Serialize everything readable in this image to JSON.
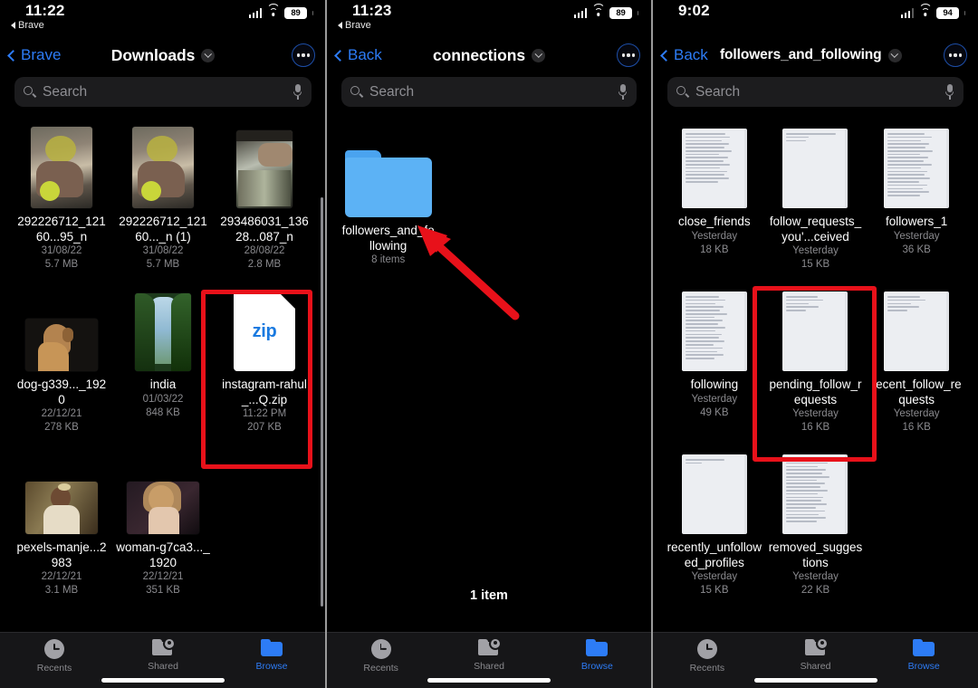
{
  "meta": {
    "app": "Files",
    "accent_blue": "#2d7cf6",
    "annotation_red": "#e8111a",
    "background": "#000000"
  },
  "panels": [
    {
      "id": "panel-1",
      "status": {
        "time": "11:22",
        "back_app": "Brave",
        "battery": "89",
        "signal_bars": 4,
        "wifi": true
      },
      "nav": {
        "back_label": "Brave",
        "title": "Downloads",
        "more_label": "More"
      },
      "search": {
        "placeholder": "Search"
      },
      "files": [
        {
          "name": "292226712_12160...95_n",
          "date": "31/08/22",
          "size": "5.7 MB",
          "kind": "photo-portrait",
          "highlight": false
        },
        {
          "name": "292226712_12160..._n (1)",
          "date": "31/08/22",
          "size": "5.7 MB",
          "kind": "photo-portrait",
          "highlight": false
        },
        {
          "name": "293486031_13628...087_n",
          "date": "28/08/22",
          "size": "2.8 MB",
          "kind": "photo-tall",
          "highlight": false
        },
        {
          "name": "dog-g339..._1920",
          "date": "22/12/21",
          "size": "278 KB",
          "kind": "photo-land-dog",
          "highlight": false
        },
        {
          "name": "india",
          "date": "01/03/22",
          "size": "848 KB",
          "kind": "photo-tall-india",
          "highlight": false
        },
        {
          "name": "instagram-rahul_...Q.zip",
          "date": "11:22 PM",
          "size": "207 KB",
          "kind": "zip",
          "highlight": true
        },
        {
          "name": "pexels-manje...2983",
          "date": "22/12/21",
          "size": "3.1 MB",
          "kind": "photo-land-woman1",
          "highlight": false
        },
        {
          "name": "woman-g7ca3..._1920",
          "date": "22/12/21",
          "size": "351 KB",
          "kind": "photo-land-woman2",
          "highlight": false
        }
      ],
      "tabs": [
        {
          "label": "Recents",
          "icon": "clock-icon",
          "active": false
        },
        {
          "label": "Shared",
          "icon": "shared-folder-icon",
          "active": false
        },
        {
          "label": "Browse",
          "icon": "folder-icon",
          "active": true
        }
      ]
    },
    {
      "id": "panel-2",
      "status": {
        "time": "11:23",
        "back_app": "Brave",
        "battery": "89",
        "signal_bars": 4,
        "wifi": true
      },
      "nav": {
        "back_label": "Back",
        "title": "connections",
        "more_label": "More"
      },
      "search": {
        "placeholder": "Search"
      },
      "files": [
        {
          "name": "followers_and_following",
          "date": "8 items",
          "size": "",
          "kind": "folder",
          "highlight": false
        }
      ],
      "item_count": "1 item",
      "tabs": [
        {
          "label": "Recents",
          "icon": "clock-icon",
          "active": false
        },
        {
          "label": "Shared",
          "icon": "shared-folder-icon",
          "active": false
        },
        {
          "label": "Browse",
          "icon": "folder-icon",
          "active": true
        }
      ]
    },
    {
      "id": "panel-3",
      "status": {
        "time": "9:02",
        "back_app": "",
        "battery": "94",
        "signal_bars": 3,
        "wifi": true
      },
      "nav": {
        "back_label": "Back",
        "title": "followers_and_following",
        "more_label": "More"
      },
      "search": {
        "placeholder": "Search"
      },
      "files": [
        {
          "name": "close_friends",
          "date": "Yesterday",
          "size": "18 KB",
          "kind": "doc-dense",
          "highlight": false
        },
        {
          "name": "follow_requests_you'...ceived",
          "date": "Yesterday",
          "size": "15 KB",
          "kind": "doc-sparse",
          "highlight": false
        },
        {
          "name": "followers_1",
          "date": "Yesterday",
          "size": "36 KB",
          "kind": "doc-dense",
          "highlight": false
        },
        {
          "name": "following",
          "date": "Yesterday",
          "size": "49 KB",
          "kind": "doc-dense",
          "highlight": false
        },
        {
          "name": "pending_follow_requests",
          "date": "Yesterday",
          "size": "16 KB",
          "kind": "doc-sparse",
          "highlight": true
        },
        {
          "name": "recent_follow_requests",
          "date": "Yesterday",
          "size": "16 KB",
          "kind": "doc-sparse",
          "highlight": false
        },
        {
          "name": "recently_unfollowed_profiles",
          "date": "Yesterday",
          "size": "15 KB",
          "kind": "doc-blank",
          "highlight": false
        },
        {
          "name": "removed_suggestions",
          "date": "Yesterday",
          "size": "22 KB",
          "kind": "doc-dense",
          "highlight": false
        }
      ],
      "tabs": [
        {
          "label": "Recents",
          "icon": "clock-icon",
          "active": false
        },
        {
          "label": "Shared",
          "icon": "shared-folder-icon",
          "active": false
        },
        {
          "label": "Browse",
          "icon": "folder-icon",
          "active": true
        }
      ]
    }
  ],
  "annotations": {
    "red_boxes": [
      {
        "panel": "panel-1",
        "target": "instagram-rahul_...Q.zip"
      },
      {
        "panel": "panel-3",
        "target": "pending_follow_requests"
      }
    ],
    "arrow": {
      "panel": "panel-2",
      "points_to": "followers_and_following"
    }
  }
}
